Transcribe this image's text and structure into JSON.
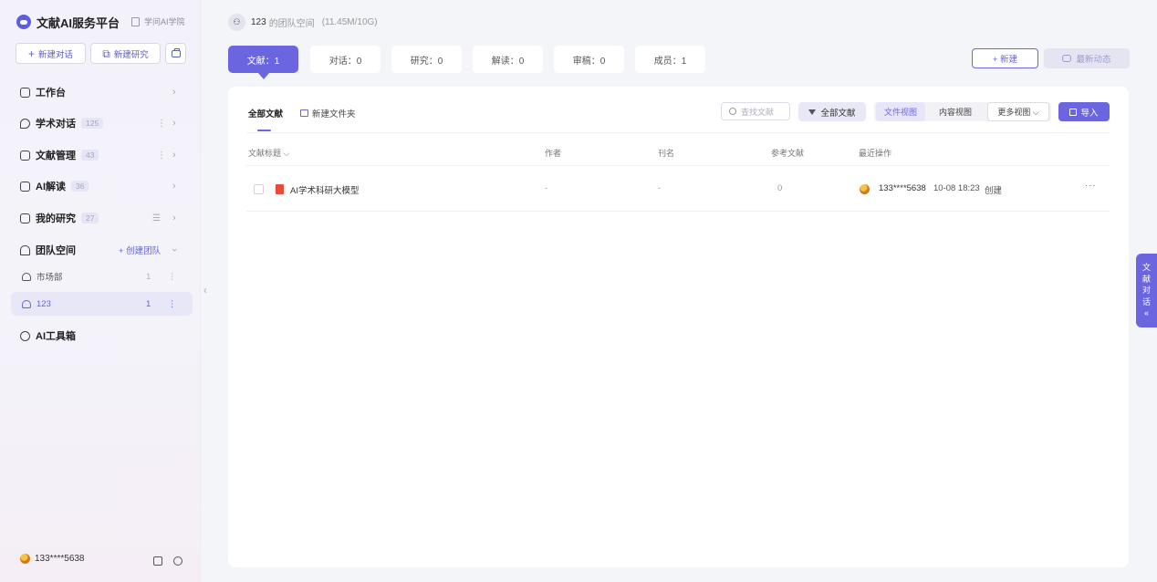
{
  "sidebar": {
    "app_title": "文献AI服务平台",
    "academy_link": "学问AI学院",
    "new_chat_label": "新建对话",
    "new_research_label": "新建研究",
    "nav": [
      {
        "label": "工作台"
      },
      {
        "label": "学术对话",
        "count": "125"
      },
      {
        "label": "文献管理",
        "count": "43"
      },
      {
        "label": "AI解读",
        "count": "36"
      },
      {
        "label": "我的研究",
        "count": "27"
      },
      {
        "label": "团队空间",
        "action": "+ 创建团队"
      },
      {
        "label": "AI工具箱"
      }
    ],
    "teams": [
      {
        "label": "市场部",
        "count": "1"
      },
      {
        "label": "123",
        "count": "1"
      }
    ],
    "user_phone": "133****5638"
  },
  "header": {
    "team_name": "123",
    "team_suffix": "的团队空间",
    "storage": "(11.45M/10G)"
  },
  "tabs": [
    {
      "label": "文献：1"
    },
    {
      "label": "对话：0"
    },
    {
      "label": "研究：0"
    },
    {
      "label": "解读：0"
    },
    {
      "label": "审稿：0"
    },
    {
      "label": "成员：1"
    }
  ],
  "actions": {
    "new_label": "+ 新建",
    "news_label": "最新动态"
  },
  "panel": {
    "tab_all": "全部文献",
    "new_folder": "新建文件夹",
    "search_placeholder": "查找文献",
    "filter_label": "全部文献",
    "views": [
      "文件视图",
      "内容视图",
      "更多视图 ⌵"
    ],
    "import_label": "导入",
    "columns": [
      "文献标题 ⌵",
      "作者",
      "刊名",
      "参考文献",
      "最近操作"
    ],
    "rows": [
      {
        "title": "AI学术科研大模型",
        "author": "-",
        "journal": "-",
        "refs": "0",
        "op_user": "133****5638",
        "op_time": "10-08 18:23",
        "op_action": "创建",
        "more": "···"
      }
    ]
  },
  "float_tab": [
    "文",
    "献",
    "对",
    "话",
    "«"
  ],
  "colors": {
    "accent": "#6b66e0",
    "pdf": "#ea4a3c"
  }
}
